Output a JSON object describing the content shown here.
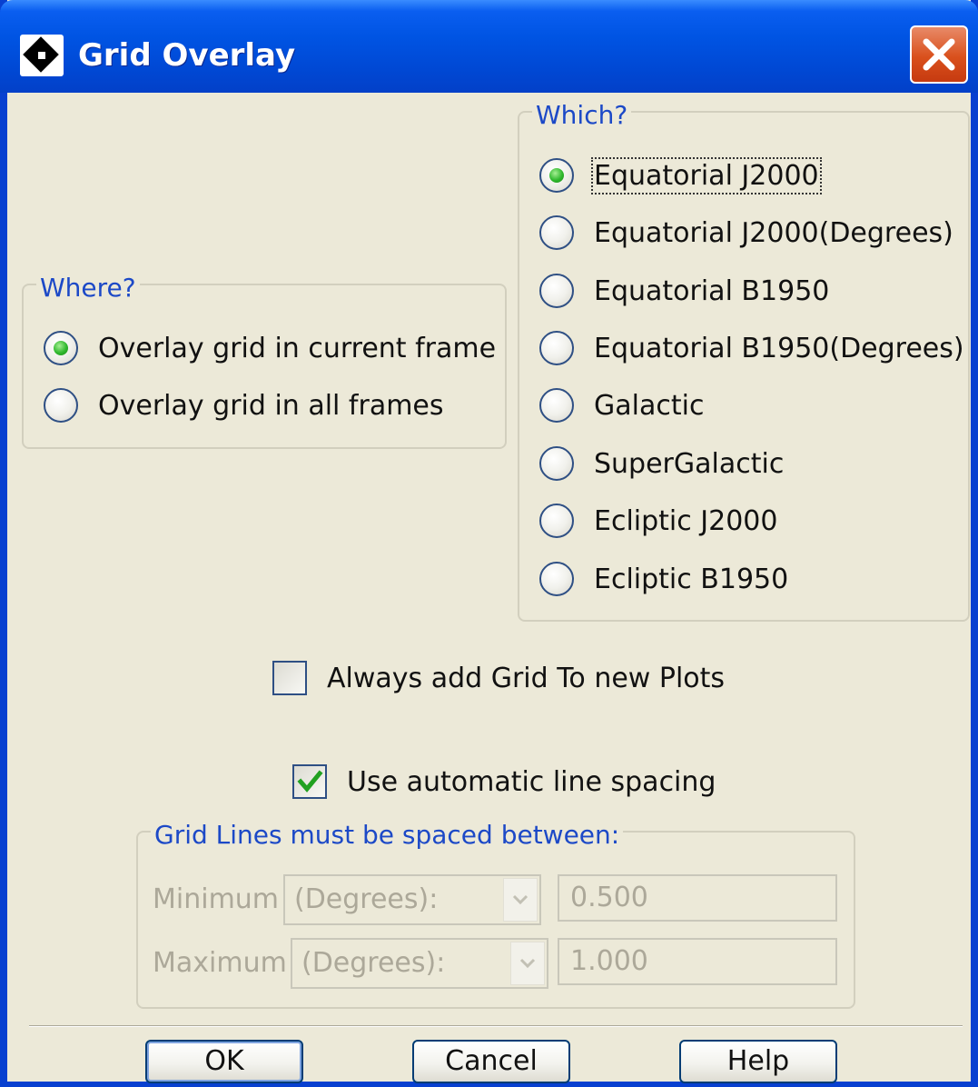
{
  "window": {
    "title": "Grid Overlay",
    "icon": "app-diamond-icon",
    "close_icon": "close-icon",
    "accent": "#0054e3",
    "close_color": "#d9501c"
  },
  "where": {
    "title": "Where?",
    "options": [
      {
        "label": "Overlay grid in current frame",
        "selected": true
      },
      {
        "label": "Overlay grid in all frames",
        "selected": false
      }
    ]
  },
  "which": {
    "title": "Which?",
    "options": [
      {
        "label": "Equatorial J2000",
        "selected": true
      },
      {
        "label": "Equatorial J2000(Degrees)",
        "selected": false
      },
      {
        "label": "Equatorial B1950",
        "selected": false
      },
      {
        "label": "Equatorial B1950(Degrees)",
        "selected": false
      },
      {
        "label": "Galactic",
        "selected": false
      },
      {
        "label": "SuperGalactic",
        "selected": false
      },
      {
        "label": "Ecliptic J2000",
        "selected": false
      },
      {
        "label": "Ecliptic B1950",
        "selected": false
      }
    ]
  },
  "always_add": {
    "label": "Always add Grid To new Plots",
    "checked": false
  },
  "auto_spacing": {
    "label": "Use automatic line spacing",
    "checked": true
  },
  "spacing": {
    "title": "Grid Lines must be spaced between:",
    "min_label": "Minimum",
    "min_unit": "(Degrees):",
    "min_value": "0.500",
    "max_label": "Maximum",
    "max_unit": "(Degrees):",
    "max_value": "1.000"
  },
  "buttons": {
    "ok": "OK",
    "cancel": "Cancel",
    "help": "Help"
  },
  "colors": {
    "group_title": "#1c49c7",
    "radio_selected": "#2fb82e",
    "check_mark": "#21a121",
    "disabled_text": "#aca899"
  }
}
